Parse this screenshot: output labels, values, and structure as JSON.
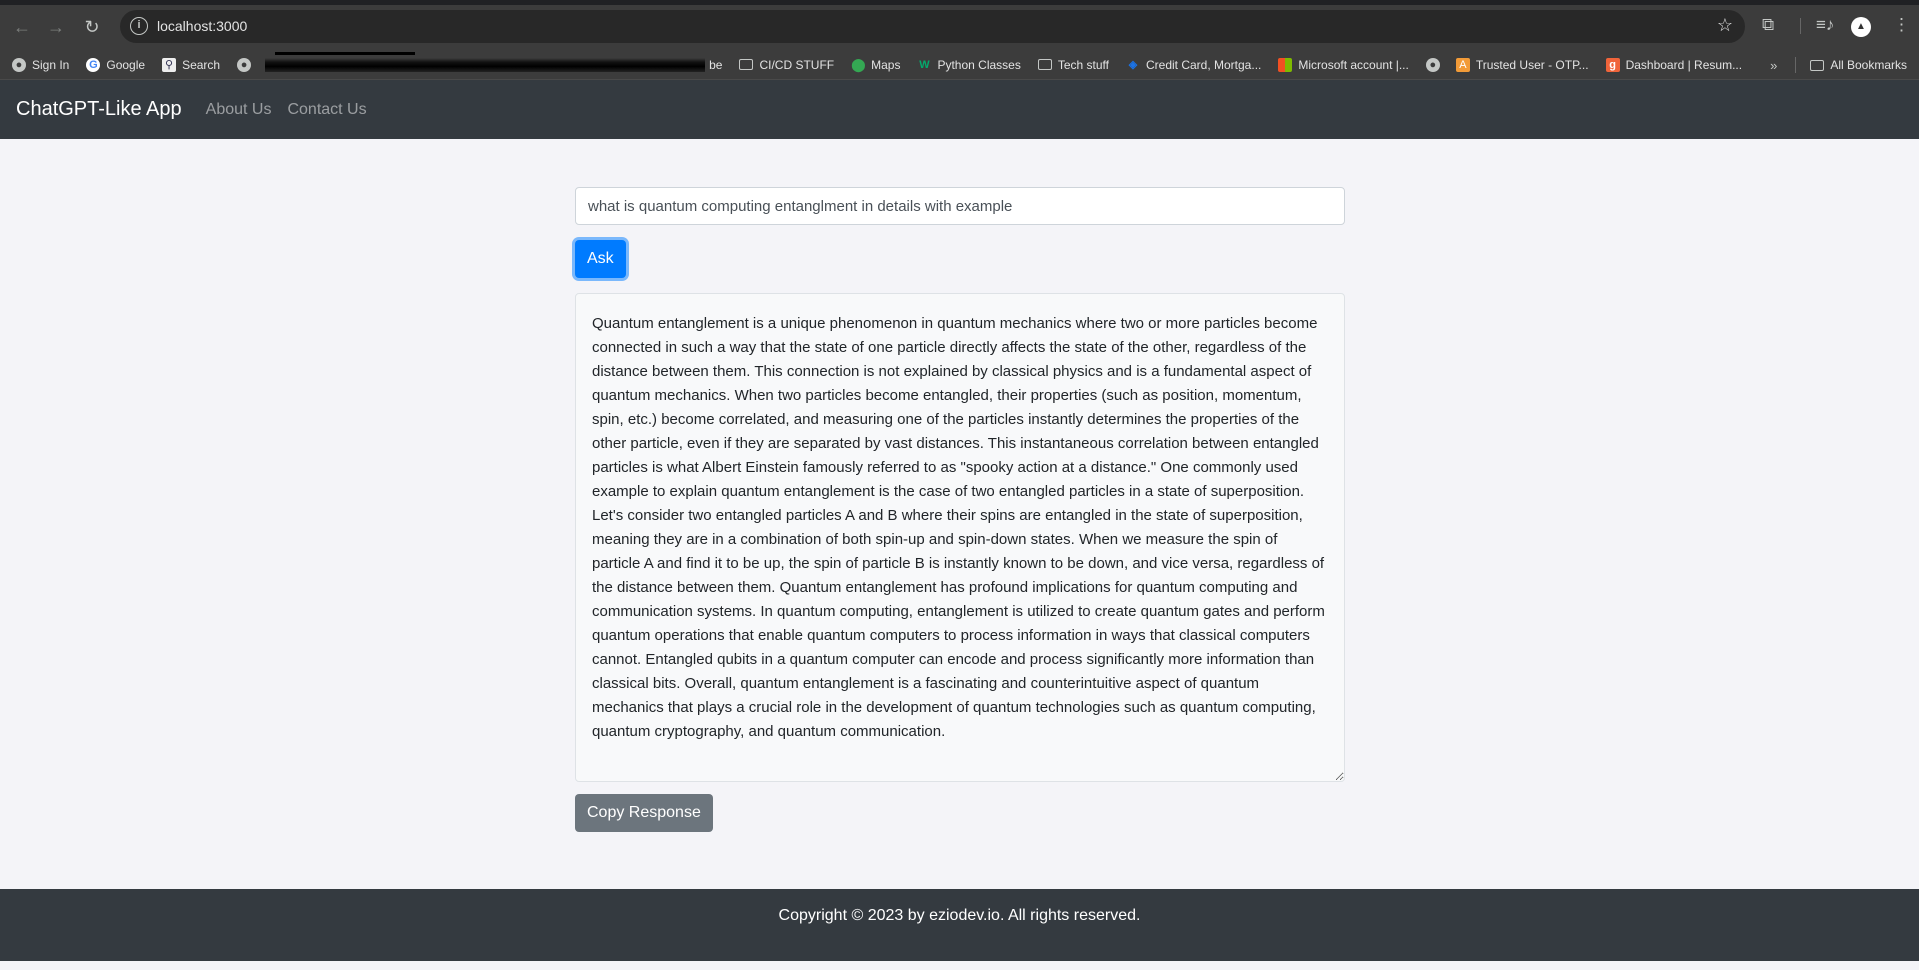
{
  "browser": {
    "url": "localhost:3000",
    "bookmarks": [
      {
        "label": "Sign In",
        "icon": "globe-icon"
      },
      {
        "label": "Google",
        "icon": "google-icon"
      },
      {
        "label": "Search",
        "icon": "search-icon"
      },
      {
        "label": "",
        "icon": "globe-icon"
      },
      {
        "label": "be",
        "icon": "redacted"
      },
      {
        "label": "CI/CD STUFF",
        "icon": "folder-icon"
      },
      {
        "label": "Maps",
        "icon": "maps-pin-icon"
      },
      {
        "label": "Python Classes",
        "icon": "w3-icon"
      },
      {
        "label": "Tech stuff",
        "icon": "folder-icon"
      },
      {
        "label": "Credit Card, Mortga...",
        "icon": "chase-icon"
      },
      {
        "label": "Microsoft account |...",
        "icon": "microsoft-icon"
      },
      {
        "label": "",
        "icon": "globe-icon"
      },
      {
        "label": "Trusted User - OTP...",
        "icon": "trusted-user-icon"
      },
      {
        "label": "Dashboard | Resum...",
        "icon": "g-icon"
      }
    ],
    "more_bookmarks": "»",
    "all_bookmarks": "All Bookmarks"
  },
  "navbar": {
    "brand": "ChatGPT-Like App",
    "links": [
      "About Us",
      "Contact Us"
    ]
  },
  "main": {
    "question_value": "what is quantum computing entanglment in details with example",
    "ask_label": "Ask",
    "response": "Quantum entanglement is a unique phenomenon in quantum mechanics where two or more particles become connected in such a way that the state of one particle directly affects the state of the other, regardless of the distance between them. This connection is not explained by classical physics and is a fundamental aspect of quantum mechanics. When two particles become entangled, their properties (such as position, momentum, spin, etc.) become correlated, and measuring one of the particles instantly determines the properties of the other particle, even if they are separated by vast distances. This instantaneous correlation between entangled particles is what Albert Einstein famously referred to as \"spooky action at a distance.\" One commonly used example to explain quantum entanglement is the case of two entangled particles in a state of superposition. Let's consider two entangled particles A and B where their spins are entangled in the state of superposition, meaning they are in a combination of both spin-up and spin-down states. When we measure the spin of particle A and find it to be up, the spin of particle B is instantly known to be down, and vice versa, regardless of the distance between them. Quantum entanglement has profound implications for quantum computing and communication systems. In quantum computing, entanglement is utilized to create quantum gates and perform quantum operations that enable quantum computers to process information in ways that classical computers cannot. Entangled qubits in a quantum computer can encode and process significantly more information than classical bits. Overall, quantum entanglement is a fascinating and counterintuitive aspect of quantum mechanics that plays a crucial role in the development of quantum technologies such as quantum computing, quantum cryptography, and quantum communication.",
    "copy_label": "Copy Response"
  },
  "footer": {
    "text": "Copyright © 2023 by eziodev.io. All rights reserved."
  },
  "colors": {
    "navbar_bg": "#343a40",
    "primary": "#007bff",
    "secondary": "#6c757d",
    "page_bg": "#f4f4f8"
  }
}
